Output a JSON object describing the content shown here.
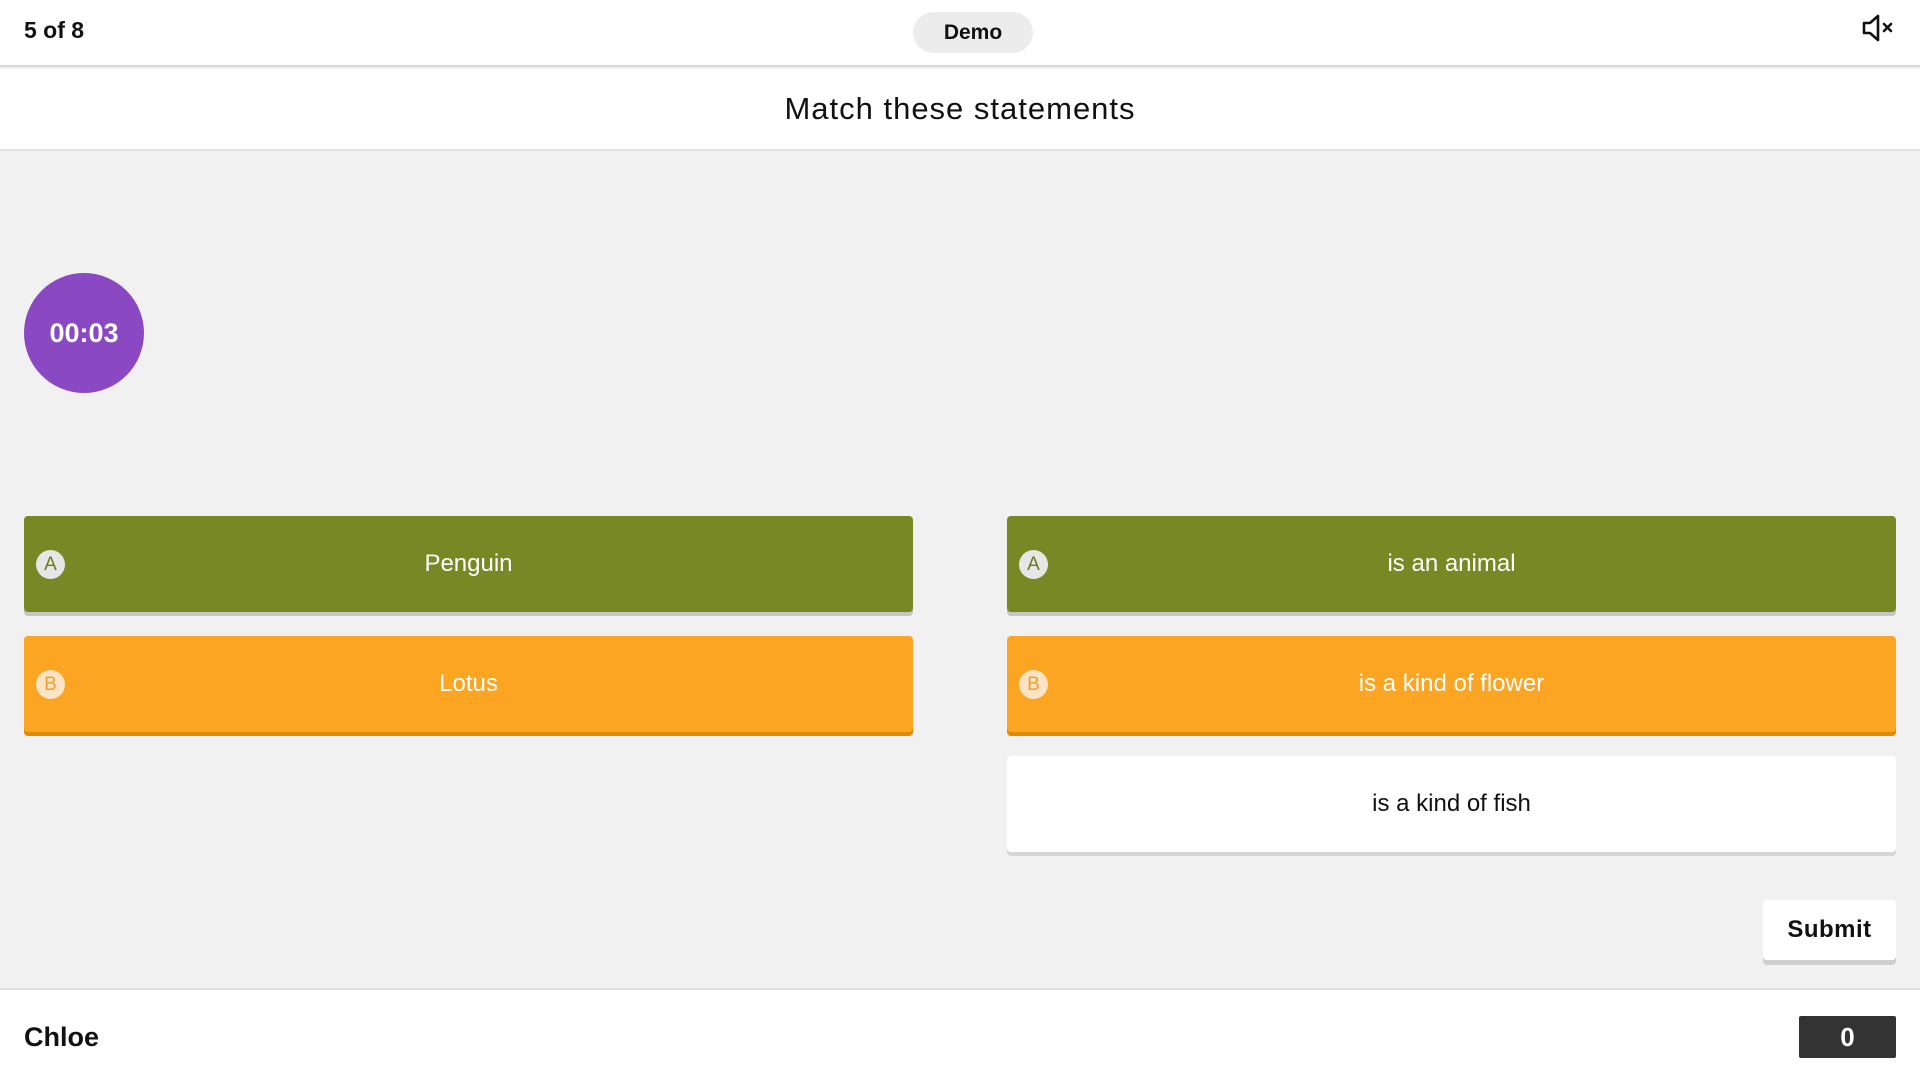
{
  "header": {
    "progress": "5 of 8",
    "mode": "Demo",
    "mute_icon": "volume-muted-icon"
  },
  "question": {
    "title": "Match these statements"
  },
  "timer": {
    "value": "00:03",
    "color": "#8a48c2"
  },
  "left_items": [
    {
      "badge": "A",
      "label": "Penguin",
      "color": "#788824"
    },
    {
      "badge": "B",
      "label": "Lotus",
      "color": "#fba522"
    }
  ],
  "right_items": [
    {
      "badge": "A",
      "label": "is an animal",
      "color": "#788824"
    },
    {
      "badge": "B",
      "label": "is a kind of flower",
      "color": "#fba522"
    },
    {
      "badge": "",
      "label": "is a kind of fish",
      "color": "#ffffff"
    }
  ],
  "actions": {
    "submit_label": "Submit"
  },
  "footer": {
    "player_name": "Chloe",
    "score": "0"
  }
}
